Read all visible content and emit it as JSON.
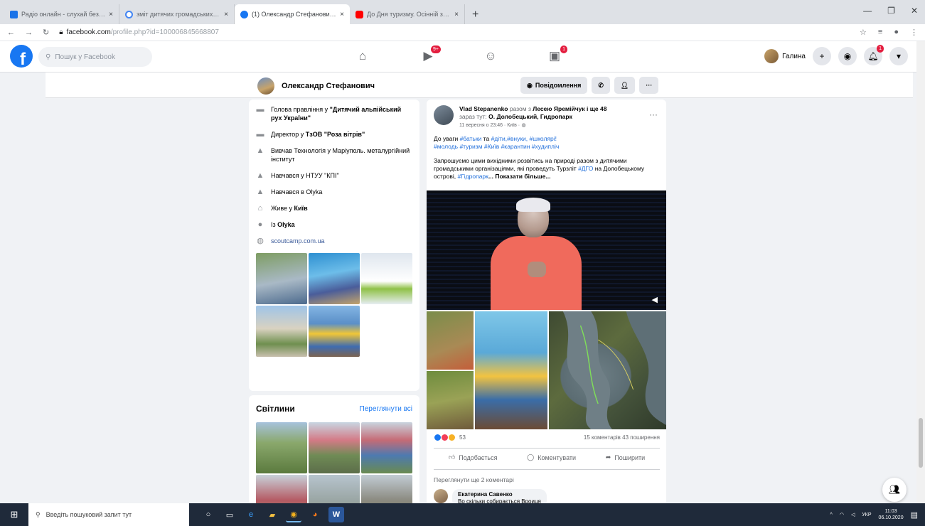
{
  "browser": {
    "tabs": [
      {
        "title": "Радіо онлайн - слухай безкош...",
        "active": false,
        "color": "#1a73e8"
      },
      {
        "title": "зміт дитячих громадських орга...",
        "active": false,
        "color": "#4285f4"
      },
      {
        "title": "(1) Олександр Стефанович | Fa...",
        "active": true,
        "color": "#1877f2"
      },
      {
        "title": "До Дня туризму. Осінній зліт ...",
        "active": false,
        "color": "#ff0000"
      }
    ],
    "tab_close": "×",
    "new_tab": "+",
    "url_host": "facebook.com",
    "url_path": "/profile.php?id=100006845668807"
  },
  "fb_header": {
    "logo": "f",
    "search_placeholder": "Пошук у Facebook",
    "badges": {
      "watch": "9+",
      "gaming": "1",
      "notifications": "1"
    },
    "user_name": "Галина"
  },
  "profile": {
    "name": "Олександр Стефанович",
    "actions": {
      "message": "Повідомлення",
      "more": "···"
    }
  },
  "intro": {
    "items": [
      {
        "icon": "briefcase-icon",
        "prefix": "Голова правління у ",
        "bold": "\"Дитячий альпійський рух України\""
      },
      {
        "icon": "briefcase-icon",
        "prefix": "Директор у ",
        "bold": "ТзОВ \"Роза вітрів\""
      },
      {
        "icon": "graduation-cap-icon",
        "prefix": "Вивчав Технологія у Маріуполь. металургійний інститут",
        "bold": ""
      },
      {
        "icon": "graduation-cap-icon",
        "prefix": "Навчався у НТУУ \"КПІ\"",
        "bold": ""
      },
      {
        "icon": "graduation-cap-icon",
        "prefix": "Навчався в Olyka",
        "bold": ""
      },
      {
        "icon": "home-icon",
        "prefix": "Живе у ",
        "bold": "Київ"
      },
      {
        "icon": "location-pin-icon",
        "prefix": "Із ",
        "bold": "Olyka"
      },
      {
        "icon": "globe-icon",
        "prefix": "",
        "bold": "",
        "link": "scoutcamp.com.ua"
      }
    ]
  },
  "photos": {
    "title": "Світлини",
    "link": "Переглянути всі"
  },
  "post": {
    "author": "Vlad Stepanenko",
    "with_word": "разом з",
    "with_names": "Лесею Яремійчук",
    "and_more": "і ще 48",
    "place_prefix": "зараз тут:",
    "place": "О. Долобецький, Гидропарк",
    "time": "11 вересня о 23:46 · Київ ·",
    "more_icon": "···",
    "text1_prefix": "До уваги",
    "tags1": [
      "#батьки",
      "та",
      "#діти,#внуки,",
      "#школярі!"
    ],
    "tags2": "#молодь #туризм #Київ #карантин #худипліч",
    "text2": "Запрошуємо цими вихідними розвітись на природі разом з дитячими громадськими організаціями, які проведуть Турзліт",
    "tag_dgo": "#ДГО",
    "text3": "на Долобецькому острові,",
    "tag_park": "#Гідропарк",
    "see_more": "... Показати більше...",
    "reactions_count": "53",
    "comments_shares": "15 коментарів 43 поширення",
    "like": "Подобається",
    "comment": "Коментувати",
    "share": "Поширити",
    "view_more_comments": "Переглянути ще 2 коментарі",
    "first_comment_author": "Екатерина Савенко",
    "first_comment_text": "Во скільки собирається Вроиця"
  },
  "taskbar": {
    "search_placeholder": "Введіть пошуковий запит тут",
    "lang": "УКР",
    "time": "11:03",
    "date": "06.10.2020"
  }
}
